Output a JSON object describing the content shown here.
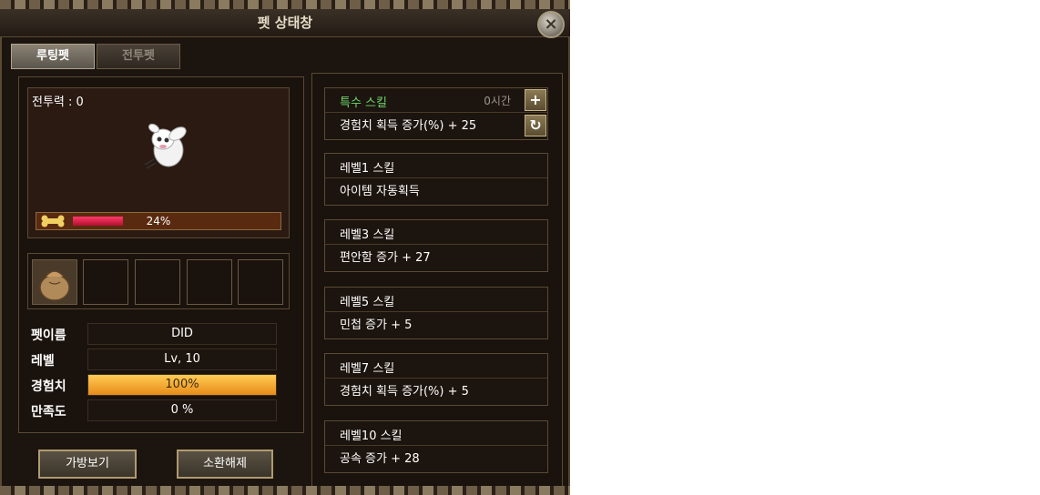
{
  "window": {
    "title": "펫 상태창"
  },
  "tabs": [
    {
      "label": "루팅펫",
      "active": true
    },
    {
      "label": "전투펫",
      "active": false
    }
  ],
  "pet": {
    "power_label": "전투력 : 0",
    "satiety_percent": 24,
    "satiety_text": "24%"
  },
  "stats": {
    "name_label": "펫이름",
    "name_value": "DID",
    "level_label": "레벨",
    "level_value": "Lv, 10",
    "exp_label": "경험치",
    "exp_value": "100%",
    "exp_percent": 100,
    "satisfaction_label": "만족도",
    "satisfaction_value": "0 %"
  },
  "buttons": {
    "bag": "가방보기",
    "release": "소환해제"
  },
  "special_skill": {
    "title": "특수 스킬",
    "hours": "0시간",
    "effect": "경험치 획득 증가(%) + 25"
  },
  "skills": [
    {
      "title": "레벨1 스킬",
      "effect": "아이템 자동획득"
    },
    {
      "title": "레벨3 스킬",
      "effect": "편안함 증가 + 27"
    },
    {
      "title": "레벨5 스킬",
      "effect": "민첩 증가 + 5"
    },
    {
      "title": "레벨7 스킬",
      "effect": "경험치 획득 증가(%) + 5"
    },
    {
      "title": "레벨10 스킬",
      "effect": "공속 증가 + 28"
    }
  ],
  "colors": {
    "accent_green": "#6ed86e",
    "satiety_red": "#ff3a6a",
    "exp_orange": "#e88a18"
  },
  "icons": [
    "close-icon",
    "bone-icon",
    "plus-icon",
    "refresh-icon",
    "pouch-icon"
  ]
}
